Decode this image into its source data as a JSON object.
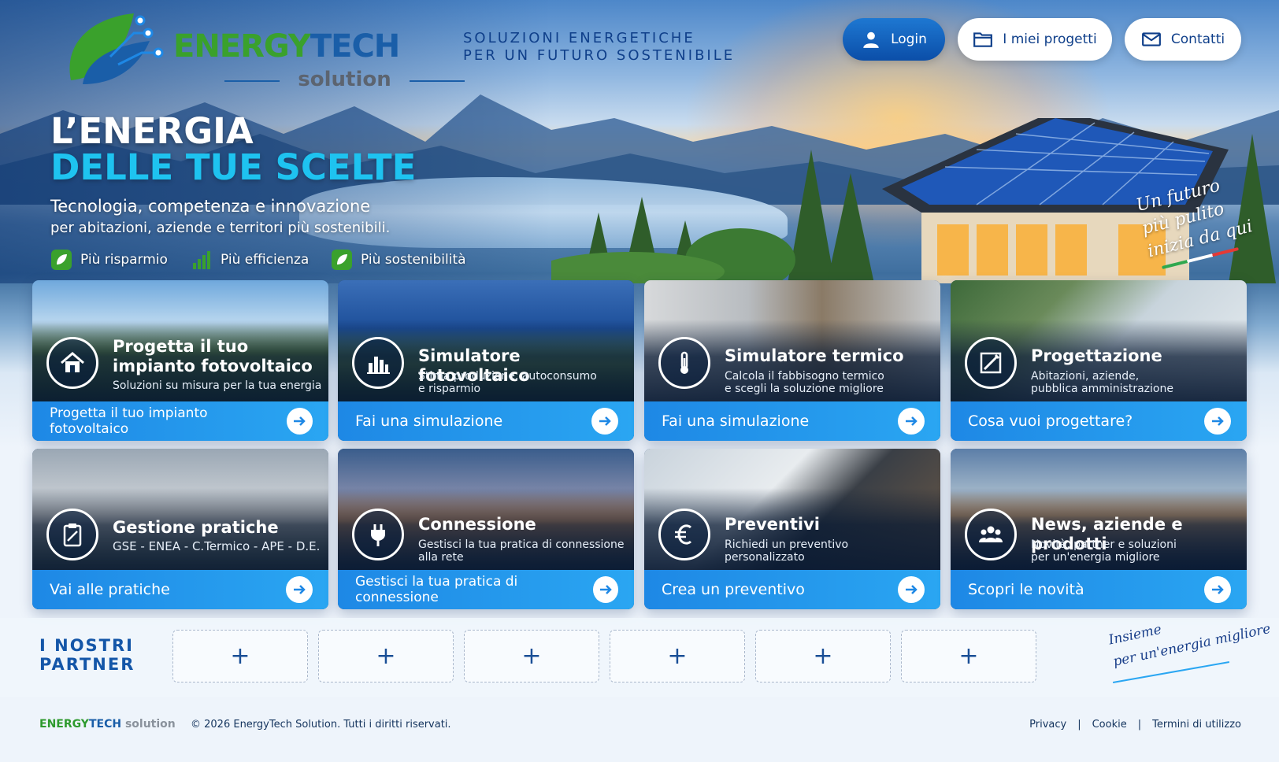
{
  "header": {
    "logo": {
      "title_part1": "ENERGY",
      "title_part2": "TECH",
      "subtitle": "solution"
    },
    "tagline_line1": "SOLUZIONI ENERGETICHE",
    "tagline_line2": "PER UN FUTURO SOSTENIBILE",
    "buttons": {
      "login": "Login",
      "projects": "I miei progetti",
      "contacts": "Contatti"
    }
  },
  "hero": {
    "title_line1": "L’ENERGIA",
    "title_line2": "DELLE TUE SCELTE",
    "subtitle_line1": "Tecnologia, competenza e innovazione",
    "subtitle_line2": "per abitazioni, aziende e territori più sostenibili.",
    "features": [
      "Più risparmio",
      "Più efficienza",
      "Più sostenibilità"
    ],
    "script_line1": "Un futuro",
    "script_line2": "più pulito",
    "script_line3": "inizia da qui"
  },
  "cards": [
    {
      "title": "Progetta il tuo impianto fotovoltaico",
      "title_l1": "Progetta il tuo",
      "title_l2": "impianto fotovoltaico",
      "sub_l1": "Soluzioni su misura per la tua energia",
      "sub_l2": "",
      "cta": "Progetta il tuo impianto fotovoltaico",
      "icon": "home-icon"
    },
    {
      "title": "Simulatore fotovoltaico",
      "sub_l1": "Stima produzione, autoconsumo",
      "sub_l2": "e risparmio",
      "cta": "Fai una simulazione",
      "icon": "bar-chart-icon"
    },
    {
      "title": "Simulatore termico",
      "sub_l1": "Calcola il fabbisogno termico",
      "sub_l2": "e scegli la soluzione migliore",
      "cta": "Fai una simulazione",
      "icon": "thermometer-icon"
    },
    {
      "title": "Progettazione",
      "sub_l1": "Abitazioni, aziende,",
      "sub_l2": "pubblica amministrazione",
      "cta": "Cosa vuoi progettare?",
      "icon": "blueprint-icon"
    },
    {
      "title": "Gestione pratiche",
      "sub_l1": "GSE - ENEA - C.Termico - APE - D.E.",
      "sub_l2": "",
      "cta": "Vai alle pratiche",
      "icon": "clipboard-icon"
    },
    {
      "title": "Connessione",
      "sub_l1": "Gestisci la tua pratica di connessione",
      "sub_l2": "alla rete",
      "cta": "Gestisci la tua pratica di connessione",
      "icon": "plug-icon"
    },
    {
      "title": "Preventivi",
      "sub_l1": "Richiedi un preventivo",
      "sub_l2": "personalizzato",
      "cta": "Crea un preventivo",
      "icon": "euro-icon"
    },
    {
      "title": "News, aziende e prodotti",
      "sub_l1": "Novità, partner e soluzioni",
      "sub_l2": "per un'energia migliore",
      "cta": "Scopri le novità",
      "icon": "group-icon"
    }
  ],
  "partners": {
    "title_line1": "I NOSTRI",
    "title_line2": "PARTNER",
    "slots": [
      "+",
      "+",
      "+",
      "+",
      "+",
      "+"
    ],
    "script_line1": "Insieme",
    "script_line2": "per un'energia migliore"
  },
  "footer": {
    "brand_part1": "ENERGY",
    "brand_part2": "TECH",
    "brand_part3": "solution",
    "copyright": "© 2026 EnergyTech Solution. Tutti i diritti riservati.",
    "links": [
      "Privacy",
      "Cookie",
      "Termini di utilizzo"
    ],
    "separator": "|"
  },
  "colors": {
    "primary": "#1e88e5",
    "brand_green": "#3aa12c",
    "brand_blue": "#1a5ea8",
    "accent_cyan": "#1ec3f0"
  }
}
